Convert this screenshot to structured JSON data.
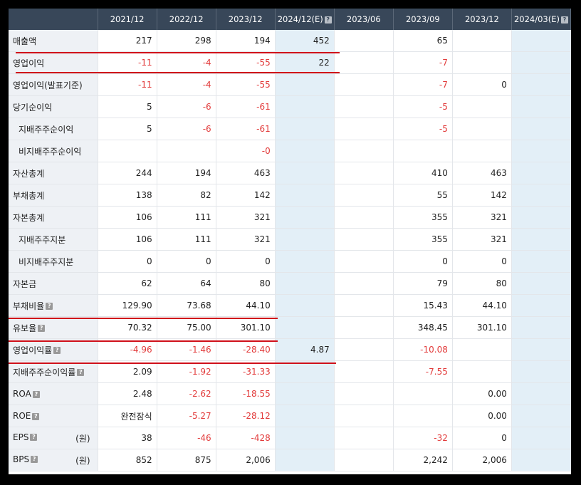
{
  "columns": [
    {
      "label": "2021/12",
      "help": false
    },
    {
      "label": "2022/12",
      "help": false
    },
    {
      "label": "2023/12",
      "help": false
    },
    {
      "label": "2024/12(E)",
      "help": true
    },
    {
      "label": "2023/06",
      "help": false
    },
    {
      "label": "2023/09",
      "help": false
    },
    {
      "label": "2023/12",
      "help": false
    },
    {
      "label": "2024/03(E)",
      "help": true
    }
  ],
  "rows": [
    {
      "label": "매출액",
      "indent": false,
      "help": false,
      "unit": "",
      "values": [
        "217",
        "298",
        "194",
        "452",
        "",
        "65",
        "",
        ""
      ]
    },
    {
      "label": "영업이익",
      "indent": false,
      "help": false,
      "unit": "",
      "values": [
        "-11",
        "-4",
        "-55",
        "22",
        "",
        "-7",
        "",
        ""
      ]
    },
    {
      "label": "영업이익(발표기준)",
      "indent": false,
      "help": false,
      "unit": "",
      "values": [
        "-11",
        "-4",
        "-55",
        "",
        "",
        "-7",
        "0",
        ""
      ]
    },
    {
      "label": "당기순이익",
      "indent": false,
      "help": false,
      "unit": "",
      "values": [
        "5",
        "-6",
        "-61",
        "",
        "",
        "-5",
        "",
        ""
      ]
    },
    {
      "label": "지배주주순이익",
      "indent": true,
      "help": false,
      "unit": "",
      "values": [
        "5",
        "-6",
        "-61",
        "",
        "",
        "-5",
        "",
        ""
      ]
    },
    {
      "label": "비지배주주순이익",
      "indent": true,
      "help": false,
      "unit": "",
      "values": [
        "",
        "",
        "-0",
        "",
        "",
        "",
        "",
        ""
      ]
    },
    {
      "label": "자산총계",
      "indent": false,
      "help": false,
      "unit": "",
      "values": [
        "244",
        "194",
        "463",
        "",
        "",
        "410",
        "463",
        ""
      ]
    },
    {
      "label": "부채총계",
      "indent": false,
      "help": false,
      "unit": "",
      "values": [
        "138",
        "82",
        "142",
        "",
        "",
        "55",
        "142",
        ""
      ]
    },
    {
      "label": "자본총계",
      "indent": false,
      "help": false,
      "unit": "",
      "values": [
        "106",
        "111",
        "321",
        "",
        "",
        "355",
        "321",
        ""
      ]
    },
    {
      "label": "지배주주지분",
      "indent": true,
      "help": false,
      "unit": "",
      "values": [
        "106",
        "111",
        "321",
        "",
        "",
        "355",
        "321",
        ""
      ]
    },
    {
      "label": "비지배주주지분",
      "indent": true,
      "help": false,
      "unit": "",
      "values": [
        "0",
        "0",
        "0",
        "",
        "",
        "0",
        "0",
        ""
      ]
    },
    {
      "label": "자본금",
      "indent": false,
      "help": false,
      "unit": "",
      "values": [
        "62",
        "64",
        "80",
        "",
        "",
        "79",
        "80",
        ""
      ]
    },
    {
      "label": "부채비율",
      "indent": false,
      "help": true,
      "unit": "",
      "values": [
        "129.90",
        "73.68",
        "44.10",
        "",
        "",
        "15.43",
        "44.10",
        ""
      ]
    },
    {
      "label": "유보율",
      "indent": false,
      "help": true,
      "unit": "",
      "values": [
        "70.32",
        "75.00",
        "301.10",
        "",
        "",
        "348.45",
        "301.10",
        ""
      ]
    },
    {
      "label": "영업이익률",
      "indent": false,
      "help": true,
      "unit": "",
      "values": [
        "-4.96",
        "-1.46",
        "-28.40",
        "4.87",
        "",
        "-10.08",
        "",
        ""
      ]
    },
    {
      "label": "지배주주순이익률",
      "indent": false,
      "help": true,
      "unit": "",
      "values": [
        "2.09",
        "-1.92",
        "-31.33",
        "",
        "",
        "-7.55",
        "",
        ""
      ]
    },
    {
      "label": "ROA",
      "indent": false,
      "help": true,
      "unit": "",
      "values": [
        "2.48",
        "-2.62",
        "-18.55",
        "",
        "",
        "",
        "0.00",
        ""
      ]
    },
    {
      "label": "ROE",
      "indent": false,
      "help": true,
      "unit": "",
      "values": [
        "완전잠식",
        "-5.27",
        "-28.12",
        "",
        "",
        "",
        "0.00",
        ""
      ]
    },
    {
      "label": "EPS",
      "indent": false,
      "help": true,
      "unit": "(원)",
      "values": [
        "38",
        "-46",
        "-428",
        "",
        "",
        "-32",
        "0",
        ""
      ]
    },
    {
      "label": "BPS",
      "indent": false,
      "help": true,
      "unit": "(원)",
      "values": [
        "852",
        "875",
        "2,006",
        "",
        "",
        "2,242",
        "2,006",
        ""
      ]
    }
  ],
  "colors": {
    "header_bg": "#384759",
    "negative": "#e23a3a",
    "highlight_line": "#d0101a",
    "estimate_bg": "#e3eff7",
    "label_bg": "#eef1f5"
  },
  "icons": {
    "help": "question-mark-icon"
  }
}
